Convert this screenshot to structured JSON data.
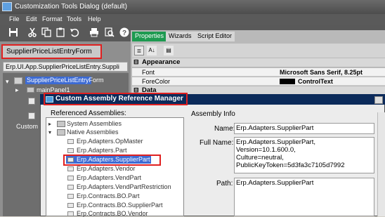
{
  "window": {
    "title": "Customization Tools Dialog (default)"
  },
  "menu": {
    "items": [
      "File",
      "Edit",
      "Format",
      "Tools",
      "Help"
    ]
  },
  "toolbar": {
    "icons": [
      "save-icon",
      "cut-icon",
      "copy-icon",
      "paste-icon",
      "undo-icon",
      "print-icon",
      "print-preview-icon",
      "help-icon"
    ]
  },
  "left": {
    "form_name": "SupplierPriceListEntryForm",
    "class_path": "Erp.UI.App.SupplierPriceListEntry.Suppli",
    "tree": {
      "selected": "SupplierPriceListEntryForm",
      "child1": "mainPanel1",
      "custom_label": "Custom R"
    }
  },
  "right": {
    "tabs": [
      "Properties",
      "Wizards",
      "Script Editor"
    ],
    "category_appearance": "Appearance",
    "rows": [
      {
        "name": "Font",
        "value": "Microsoft Sans Serif, 8.25pt"
      },
      {
        "name": "ForeColor",
        "value": "ControlText"
      }
    ],
    "category_data": "Data"
  },
  "dialog": {
    "title": "Custom Assembly Reference Manager",
    "referenced_label": "Referenced Assemblies:",
    "tree": {
      "system": "System Assemblies",
      "native": "Native Assemblies",
      "items": [
        "Erp.Adapters.OpMaster",
        "Erp.Adapters.Part",
        "Erp.Adapters.SupplierPart",
        "Erp.Adapters.Vendor",
        "Erp.Adapters.VendPart",
        "Erp.Adapters.VendPartRestriction",
        "Erp.Contracts.BO.Part",
        "Erp.Contracts.BO.SupplierPart",
        "Erp.Contracts.BO.Vendor"
      ],
      "selected_index": 2
    },
    "info": {
      "title": "Assembly Info",
      "name_label": "Name:",
      "name_value": "Erp.Adapters.SupplierPart",
      "fullname_label": "Full Name:",
      "fullname_line1": "Erp.Adapters.SupplierPart, Version=10.1.600.0,",
      "fullname_line2": "Culture=neutral,",
      "fullname_line3": "PublicKeyToken=5d3fa3c7105d7992",
      "path_label": "Path:",
      "path_value": "Erp.Adapters.SupplierPart"
    }
  },
  "colors": {
    "highlight_outline": "#e02020",
    "selection": "#3d6bd4",
    "tab_active": "#1d9a50"
  }
}
